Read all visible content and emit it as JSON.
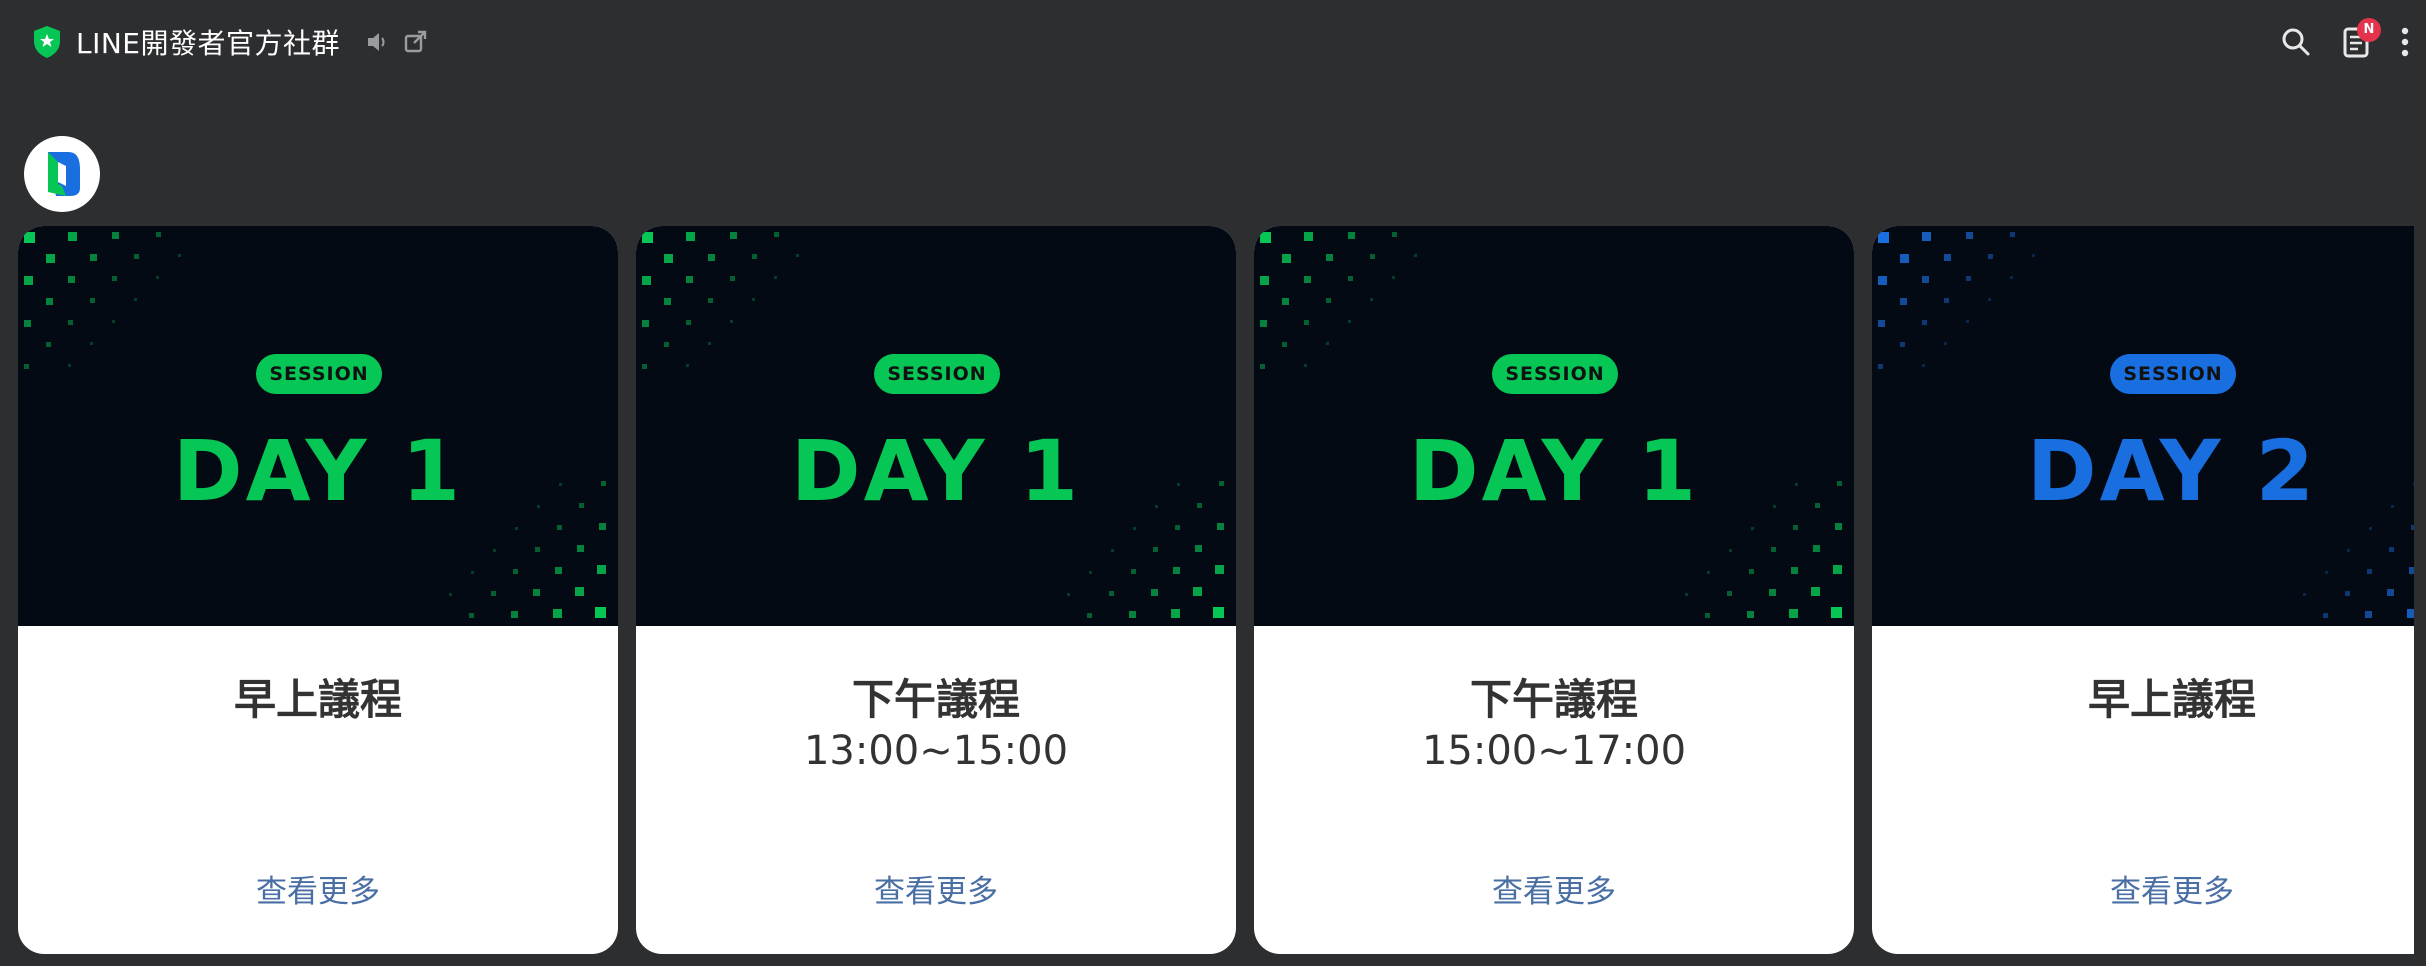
{
  "header": {
    "title": "LINE開發者官方社群",
    "icons": {
      "shield": "verified-shield-icon",
      "speaker": "speaker-icon",
      "external": "external-link-icon",
      "search": "search-icon",
      "notes": "notes-icon",
      "more": "more-vertical-icon"
    },
    "badge_text": "N"
  },
  "avatar": {
    "icon": "line-developers-logo"
  },
  "colors": {
    "background": "#2d2e30",
    "green": "#06c755",
    "blue": "#1a6fe0",
    "banner": "#040a14",
    "link": "#4a6fa5",
    "badge": "#e5334b"
  },
  "cards": [
    {
      "pill": "SESSION",
      "day": "DAY 1",
      "accent": "#06c755",
      "title": "早上議程",
      "time": "",
      "more": "查看更多"
    },
    {
      "pill": "SESSION",
      "day": "DAY 1",
      "accent": "#06c755",
      "title": "下午議程",
      "time": "13:00~15:00",
      "more": "查看更多"
    },
    {
      "pill": "SESSION",
      "day": "DAY 1",
      "accent": "#06c755",
      "title": "下午議程",
      "time": "15:00~17:00",
      "more": "查看更多"
    },
    {
      "pill": "SESSION",
      "day": "DAY 2",
      "accent": "#1a6fe0",
      "title": "早上議程",
      "time": "",
      "more": "查看更多"
    }
  ]
}
